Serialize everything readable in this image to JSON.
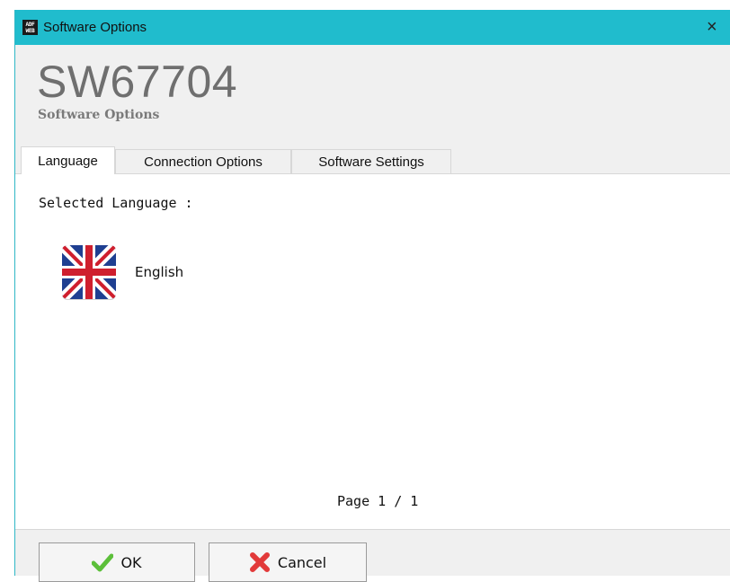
{
  "window": {
    "title": "Software Options",
    "close_glyph": "×",
    "icon_label_top": "ADF",
    "icon_label_bottom": "WEB"
  },
  "header": {
    "product_code": "SW67704",
    "subtitle": "Software Options"
  },
  "tabs": [
    {
      "label": "Language",
      "active": true
    },
    {
      "label": "Connection Options",
      "active": false
    },
    {
      "label": "Software Settings",
      "active": false
    }
  ],
  "language_tab": {
    "selected_label": "Selected Language :",
    "languages": [
      {
        "name": "English",
        "icon": "uk-flag-icon"
      }
    ],
    "page_info": "Page 1 / 1"
  },
  "footer": {
    "ok_label": "OK",
    "ok_icon": "checkmark-icon",
    "cancel_label": "Cancel",
    "cancel_icon": "red-x-icon"
  },
  "colors": {
    "titlebar": "#20bccd",
    "ok_green": "#5cbf3a",
    "cancel_red": "#e23a3a"
  }
}
